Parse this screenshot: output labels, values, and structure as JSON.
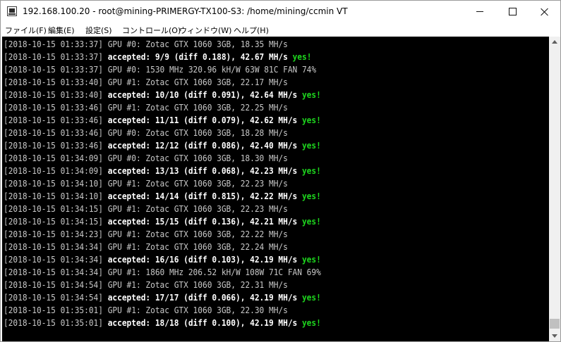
{
  "window": {
    "title": "192.168.100.20 - root@mining-PRIMERGY-TX100-S3: /home/mining/ccmin VT",
    "controls": {
      "minimize": "minimize",
      "maximize": "maximize",
      "close": "close"
    }
  },
  "menu": [
    "ファイル(F)",
    "編集(E)",
    "設定(S)",
    "コントロール(O)",
    "ウィンドウ(W)",
    "ヘルプ(H)"
  ],
  "colors": {
    "terminal_bg": "#000000",
    "normal_text": "#c8c8c8",
    "bold_text": "#ffffff",
    "yes_text": "#1ed81e"
  },
  "terminal": {
    "lines": [
      {
        "ts": "[2018-10-15 01:33:37]",
        "msg": " GPU #0: Zotac GTX 1060 3GB, 18.35 MH/s"
      },
      {
        "ts": "[2018-10-15 01:33:37]",
        "acc": " accepted: 9/9 (diff 0.188), 42.67 MH/s ",
        "yes": "yes!"
      },
      {
        "ts": "[2018-10-15 01:33:37]",
        "msg": " GPU #0: 1530 MHz 320.96 kH/W 63W 81C FAN 74%"
      },
      {
        "ts": "[2018-10-15 01:33:40]",
        "msg": " GPU #1: Zotac GTX 1060 3GB, 22.17 MH/s"
      },
      {
        "ts": "[2018-10-15 01:33:40]",
        "acc": " accepted: 10/10 (diff 0.091), 42.64 MH/s ",
        "yes": "yes!"
      },
      {
        "ts": "[2018-10-15 01:33:46]",
        "msg": " GPU #1: Zotac GTX 1060 3GB, 22.25 MH/s"
      },
      {
        "ts": "[2018-10-15 01:33:46]",
        "acc": " accepted: 11/11 (diff 0.079), 42.62 MH/s ",
        "yes": "yes!"
      },
      {
        "ts": "[2018-10-15 01:33:46]",
        "msg": " GPU #0: Zotac GTX 1060 3GB, 18.28 MH/s"
      },
      {
        "ts": "[2018-10-15 01:33:46]",
        "acc": " accepted: 12/12 (diff 0.086), 42.40 MH/s ",
        "yes": "yes!"
      },
      {
        "ts": "[2018-10-15 01:34:09]",
        "msg": " GPU #0: Zotac GTX 1060 3GB, 18.30 MH/s"
      },
      {
        "ts": "[2018-10-15 01:34:09]",
        "acc": " accepted: 13/13 (diff 0.068), 42.23 MH/s ",
        "yes": "yes!"
      },
      {
        "ts": "[2018-10-15 01:34:10]",
        "msg": " GPU #1: Zotac GTX 1060 3GB, 22.23 MH/s"
      },
      {
        "ts": "[2018-10-15 01:34:10]",
        "acc": " accepted: 14/14 (diff 0.815), 42.22 MH/s ",
        "yes": "yes!"
      },
      {
        "ts": "[2018-10-15 01:34:15]",
        "msg": " GPU #1: Zotac GTX 1060 3GB, 22.23 MH/s"
      },
      {
        "ts": "[2018-10-15 01:34:15]",
        "acc": " accepted: 15/15 (diff 0.136), 42.21 MH/s ",
        "yes": "yes!"
      },
      {
        "ts": "[2018-10-15 01:34:23]",
        "msg": " GPU #1: Zotac GTX 1060 3GB, 22.22 MH/s"
      },
      {
        "ts": "[2018-10-15 01:34:34]",
        "msg": " GPU #1: Zotac GTX 1060 3GB, 22.24 MH/s"
      },
      {
        "ts": "[2018-10-15 01:34:34]",
        "acc": " accepted: 16/16 (diff 0.103), 42.19 MH/s ",
        "yes": "yes!"
      },
      {
        "ts": "[2018-10-15 01:34:34]",
        "msg": " GPU #1: 1860 MHz 206.52 kH/W 108W 71C FAN 69%"
      },
      {
        "ts": "[2018-10-15 01:34:54]",
        "msg": " GPU #1: Zotac GTX 1060 3GB, 22.31 MH/s"
      },
      {
        "ts": "[2018-10-15 01:34:54]",
        "acc": " accepted: 17/17 (diff 0.066), 42.19 MH/s ",
        "yes": "yes!"
      },
      {
        "ts": "[2018-10-15 01:35:01]",
        "msg": " GPU #1: Zotac GTX 1060 3GB, 22.30 MH/s"
      },
      {
        "ts": "[2018-10-15 01:35:01]",
        "acc": " accepted: 18/18 (diff 0.100), 42.19 MH/s ",
        "yes": "yes!"
      }
    ]
  }
}
